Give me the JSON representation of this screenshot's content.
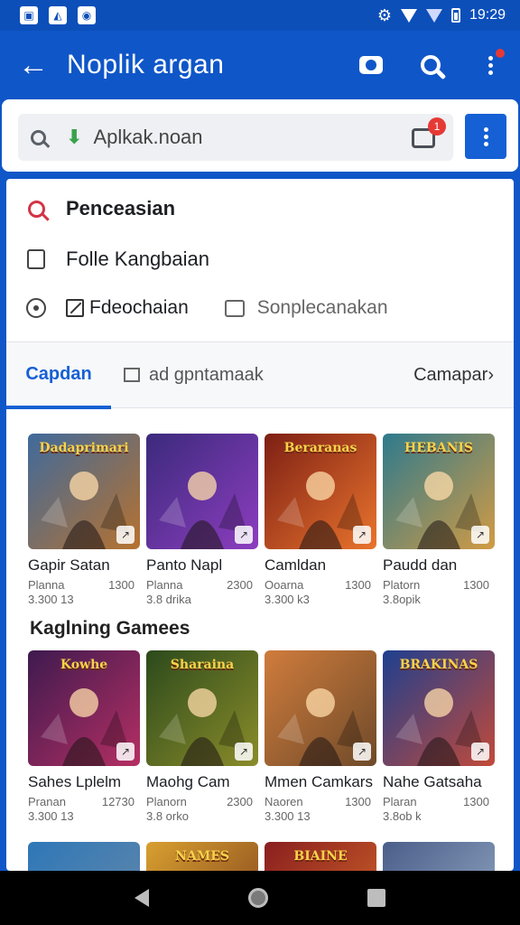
{
  "status_bar": {
    "time": "19:29"
  },
  "app_bar": {
    "title": "Noplik argan"
  },
  "search": {
    "value": "Aplkak.noan",
    "badge": "1"
  },
  "menu": {
    "item1": "Penceasian",
    "item2": "Folle Kangbaian",
    "chip1": "Fdeochaian",
    "chip2": "Sonplecanakan"
  },
  "tabs": {
    "tab1": "Capdan",
    "tab2": "ad gpntamaak",
    "tab3": "Camapar›"
  },
  "section2_title": "Kaglning Gamees",
  "row1": [
    {
      "name": "Gapir Satan",
      "sub": "Planna",
      "size": "1300",
      "count": "3.300 13",
      "art": "Dadaprimari",
      "colors": [
        "#3f6a9c",
        "#b7722f"
      ]
    },
    {
      "name": "Panto Napl",
      "sub": "Planna",
      "size": "2300",
      "count": "3.8 drika",
      "art": "",
      "colors": [
        "#3b2a7c",
        "#8d3dbf"
      ]
    },
    {
      "name": "Camldan",
      "sub": "Ooarna",
      "size": "1300",
      "count": "3.300 k3",
      "art": "Beraranas",
      "colors": [
        "#7d1f14",
        "#e9742d"
      ]
    },
    {
      "name": "Paudd dan",
      "sub": "Platorn",
      "size": "1300",
      "count": "3.8opik",
      "art": "HEBANIS",
      "colors": [
        "#2e7a8d",
        "#d29b44"
      ]
    }
  ],
  "row2": [
    {
      "name": "Sahes Lplelm",
      "sub": "Pranan",
      "size": "12730",
      "count": "3.300 13",
      "art": "Kowhe",
      "colors": [
        "#3e1a4f",
        "#b52f63"
      ]
    },
    {
      "name": "Maohg Cam",
      "sub": "Planorn",
      "size": "2300",
      "count": "3.8 orko",
      "art": "Sharaina",
      "colors": [
        "#2c4a1c",
        "#8a8c2a"
      ]
    },
    {
      "name": "Mmen Camkars",
      "sub": "Naoren",
      "size": "1300",
      "count": "3.300 13",
      "art": "",
      "colors": [
        "#d07c3c",
        "#6e4a2a"
      ]
    },
    {
      "name": "Nahe Gatsaha",
      "sub": "Plaran",
      "size": "1300",
      "count": "3.8ob k",
      "art": "BRAKINAS",
      "colors": [
        "#1e3f8f",
        "#c24a3a"
      ]
    }
  ],
  "row3": [
    {
      "art": "",
      "colors": [
        "#2e77b8",
        "#6b8aa6"
      ]
    },
    {
      "art": "NAMES",
      "colors": [
        "#d8a030",
        "#7a3a1c"
      ]
    },
    {
      "art": "BIAINE",
      "colors": [
        "#8a1f1f",
        "#d56a2a"
      ]
    },
    {
      "art": "",
      "colors": [
        "#4b5e8a",
        "#9ab0c8"
      ]
    }
  ]
}
